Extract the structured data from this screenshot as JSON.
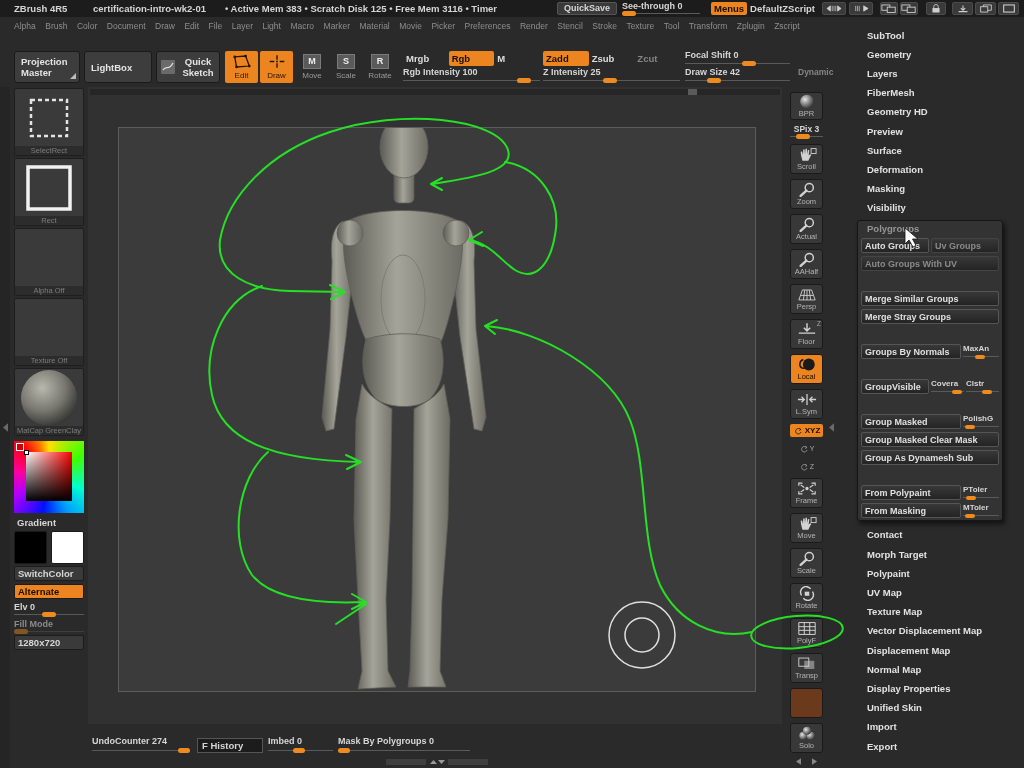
{
  "title_bar": {
    "app_name": "ZBrush 4R5",
    "document": "certification-intro-wk2-01",
    "stats": "• Active Mem 383 • Scratch Disk 125 • Free Mem 3116 • Timer",
    "quicksave": "QuickSave",
    "see_through": {
      "label": "See-through",
      "value": "0",
      "level": 0
    },
    "menus": {
      "label": "Menus",
      "on": true
    },
    "script": "DefaultZScript"
  },
  "menu_bar": [
    "Alpha",
    "Brush",
    "Color",
    "Document",
    "Draw",
    "Edit",
    "File",
    "Layer",
    "Light",
    "Macro",
    "Marker",
    "Material",
    "Movie",
    "Picker",
    "Preferences",
    "Render",
    "Stencil",
    "Stroke",
    "Texture",
    "Tool",
    "Transform",
    "Zplugin",
    "Zscript"
  ],
  "toolbar": {
    "panels": [
      {
        "label": "Projection Master"
      },
      {
        "label": "LightBox"
      },
      {
        "label": "Quick Sketch"
      }
    ],
    "modes": [
      {
        "label": "Edit",
        "on": true
      },
      {
        "label": "Draw",
        "on": true
      },
      {
        "label": "Move",
        "badge": "M",
        "on": false
      },
      {
        "label": "Scale",
        "badge": "S",
        "on": false
      },
      {
        "label": "Rotate",
        "badge": "R",
        "on": false
      }
    ],
    "color_channels": [
      {
        "label": "Mrgb",
        "on": false,
        "disabled": false
      },
      {
        "label": "Rgb",
        "on": true,
        "disabled": false
      },
      {
        "label": "M",
        "on": false,
        "disabled": false
      }
    ],
    "depth_channels": [
      {
        "label": "Zadd",
        "on": true,
        "disabled": false
      },
      {
        "label": "Zsub",
        "on": false,
        "disabled": false
      },
      {
        "label": "Zcut",
        "on": false,
        "disabled": true
      }
    ],
    "intensity": [
      {
        "label": "Rgb Intensity",
        "value": "100",
        "level": 0.93
      },
      {
        "label": "Z Intensity",
        "value": "25",
        "level": 0.49
      }
    ],
    "brush": [
      {
        "label": "Focal Shift",
        "value": "0",
        "level": 0.63
      },
      {
        "label": "Draw Size",
        "value": "42",
        "level": 0.24
      }
    ],
    "dynamic": {
      "label": "Dynamic",
      "disabled": true
    }
  },
  "left_panel": {
    "thumbnails": [
      {
        "label": "SelectRect"
      },
      {
        "label": "Rect"
      },
      {
        "label": "Alpha Off"
      },
      {
        "label": "Texture Off"
      },
      {
        "label": "MatCap GreenClay"
      }
    ],
    "gradient": "Gradient",
    "swatches": [
      {
        "color": "#000000"
      },
      {
        "color": "#ffffff"
      }
    ],
    "switch_color": "SwitchColor",
    "alternate": {
      "label": "Alternate",
      "on": true
    },
    "elevation": {
      "label": "Elv",
      "value": "0",
      "level": 0.5
    },
    "fill_mode": {
      "label": "Fill Mode",
      "level": 0,
      "disabled": true
    },
    "resolution": "1280x720"
  },
  "shelf": [
    {
      "kind": "button",
      "label": "BPR",
      "on": false
    },
    {
      "kind": "slider",
      "label": "SPix",
      "value": "3",
      "level": 0.3
    },
    {
      "kind": "button",
      "label": "Scroll",
      "on": false
    },
    {
      "kind": "button",
      "label": "Zoom",
      "on": false
    },
    {
      "kind": "button",
      "label": "Actual",
      "on": false
    },
    {
      "kind": "button",
      "label": "AAHalf",
      "on": false
    },
    {
      "kind": "button",
      "label": "Persp",
      "on": false
    },
    {
      "kind": "button",
      "label": "Floor",
      "corner": "Z",
      "on": false
    },
    {
      "kind": "button",
      "label": "Local",
      "on": true
    },
    {
      "kind": "button",
      "label": "L.Sym",
      "on": false
    },
    {
      "kind": "toggle",
      "label": "XYZ",
      "on": true
    },
    {
      "kind": "axis",
      "label": "Y",
      "on": false
    },
    {
      "kind": "axis",
      "label": "Z",
      "on": false
    },
    {
      "kind": "button",
      "label": "Frame",
      "on": false
    },
    {
      "kind": "button",
      "label": "Move",
      "on": false
    },
    {
      "kind": "button",
      "label": "Scale",
      "on": false
    },
    {
      "kind": "button",
      "label": "Rotate",
      "on": false
    },
    {
      "kind": "button",
      "label": "PolyF",
      "on": false
    },
    {
      "kind": "button",
      "label": "Transp",
      "on": false
    },
    {
      "kind": "swatch",
      "color": "#6b3a1c"
    },
    {
      "kind": "button",
      "label": "Solo",
      "on": false
    }
  ],
  "tool_palette": [
    {
      "label": "SubTool",
      "expanded": false
    },
    {
      "label": "Geometry",
      "expanded": false
    },
    {
      "label": "Layers",
      "expanded": false
    },
    {
      "label": "FiberMesh",
      "expanded": false
    },
    {
      "label": "Geometry HD",
      "expanded": false
    },
    {
      "label": "Preview",
      "expanded": false
    },
    {
      "label": "Surface",
      "expanded": false
    },
    {
      "label": "Deformation",
      "expanded": false
    },
    {
      "label": "Masking",
      "expanded": false
    },
    {
      "label": "Visibility",
      "expanded": false
    },
    {
      "label": "Polygroups",
      "expanded": true,
      "groups": [
        [
          [
            {
              "kind": "button",
              "label": "Auto Groups",
              "disabled": false
            },
            {
              "kind": "button",
              "label": "Uv Groups",
              "disabled": true
            }
          ],
          [
            {
              "kind": "button",
              "label": "Auto Groups With UV",
              "disabled": true
            }
          ]
        ],
        [
          [
            {
              "kind": "button",
              "label": "Merge Similar Groups",
              "disabled": false
            }
          ],
          [
            {
              "kind": "button",
              "label": "Merge Stray Groups",
              "disabled": false
            }
          ]
        ],
        [
          [
            {
              "kind": "button",
              "label": "Groups By Normals",
              "disabled": false
            },
            {
              "kind": "slider",
              "label": "MaxAn",
              "level": 0.46
            }
          ]
        ],
        [
          [
            {
              "kind": "button",
              "label": "GroupVisible",
              "disabled": false
            },
            {
              "kind": "slider",
              "label": "Covera",
              "level": 0.9
            },
            {
              "kind": "slider",
              "label": "Clstr",
              "level": 0.7
            }
          ]
        ],
        [
          [
            {
              "kind": "button",
              "label": "Group Masked",
              "disabled": false
            },
            {
              "kind": "slider",
              "label": "PolishG",
              "level": 0.08
            }
          ],
          [
            {
              "kind": "button",
              "label": "Group Masked Clear Mask",
              "disabled": false
            }
          ],
          [
            {
              "kind": "button",
              "label": "Group As Dynamesh Sub",
              "disabled": false
            }
          ]
        ],
        [
          [
            {
              "kind": "button",
              "label": "From Polypaint",
              "disabled": false
            },
            {
              "kind": "slider",
              "label": "PToler",
              "level": 0.12
            }
          ],
          [
            {
              "kind": "button",
              "label": "From Masking",
              "disabled": false
            },
            {
              "kind": "slider",
              "label": "MToler",
              "level": 0.08
            }
          ]
        ]
      ]
    },
    {
      "label": "Contact",
      "expanded": false
    },
    {
      "label": "Morph Target",
      "expanded": false
    },
    {
      "label": "Polypaint",
      "expanded": false
    },
    {
      "label": "UV Map",
      "expanded": false
    },
    {
      "label": "Texture Map",
      "expanded": false
    },
    {
      "label": "Vector Displacement Map",
      "expanded": false
    },
    {
      "label": "Displacement Map",
      "expanded": false
    },
    {
      "label": "Normal Map",
      "expanded": false
    },
    {
      "label": "Display Properties",
      "expanded": false
    },
    {
      "label": "Unified Skin",
      "expanded": false
    },
    {
      "label": "Import",
      "expanded": false
    },
    {
      "label": "Export",
      "expanded": false
    }
  ],
  "bottom_bar": [
    {
      "kind": "slider",
      "label": "UndoCounter",
      "value": "274",
      "level": 1
    },
    {
      "kind": "button",
      "label": "F History"
    },
    {
      "kind": "slider",
      "label": "Imbed",
      "value": "0",
      "level": 0.47
    },
    {
      "kind": "slider",
      "label": "Mask By Polygroups",
      "value": "0",
      "level": 0
    }
  ]
}
